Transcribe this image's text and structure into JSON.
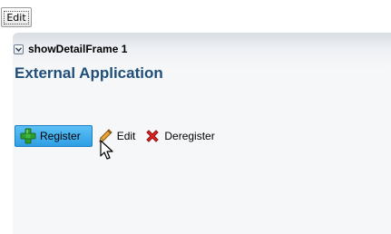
{
  "toolbar": {
    "edit_label": "Edit"
  },
  "panel": {
    "title": "showDetailFrame 1",
    "heading": "External Application",
    "colors": {
      "heading": "#1f4e79",
      "active_button": "#2e9fe4"
    }
  },
  "actions": [
    {
      "label": "Register",
      "icon": "plus-icon",
      "state": "hovered"
    },
    {
      "label": "Edit",
      "icon": "pencil-icon"
    },
    {
      "label": "Deregister",
      "icon": "red-x-icon"
    }
  ]
}
